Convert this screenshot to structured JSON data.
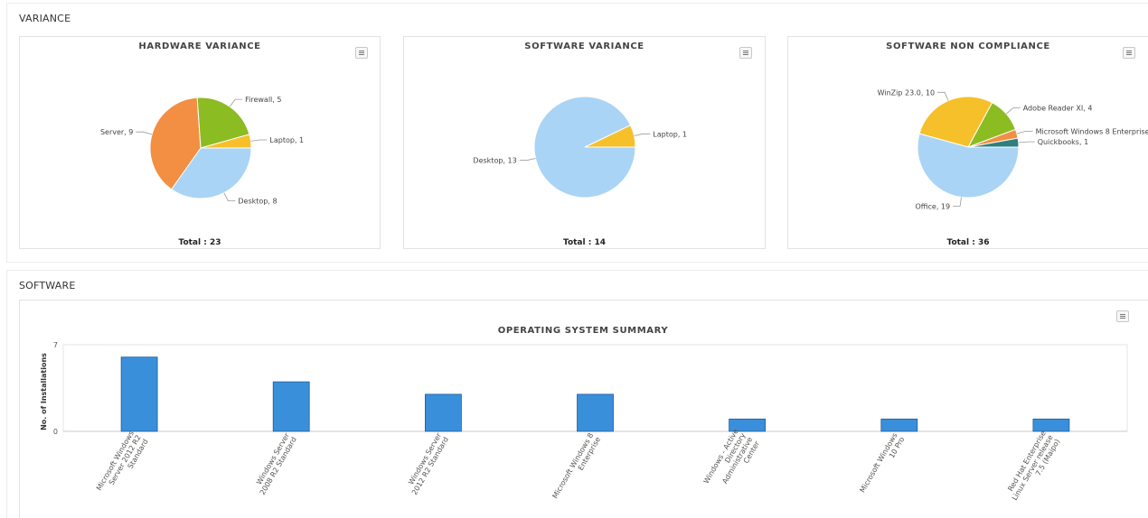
{
  "variance_section": {
    "title": "VARIANCE"
  },
  "software_section": {
    "title": "SOFTWARE"
  },
  "chart_data": [
    {
      "type": "pie",
      "title": "HARDWARE VARIANCE",
      "total_label": "Total : 23",
      "slices": [
        {
          "label": "Desktop, 8",
          "value": 8,
          "color": "#aad4f5"
        },
        {
          "label": "Server, 9",
          "value": 9,
          "color": "#f28f43"
        },
        {
          "label": "Firewall, 5",
          "value": 5,
          "color": "#8bbc21"
        },
        {
          "label": "Laptop, 1",
          "value": 1,
          "color": "#f6c02a"
        }
      ]
    },
    {
      "type": "pie",
      "title": "SOFTWARE VARIANCE",
      "total_label": "Total : 14",
      "slices": [
        {
          "label": "Laptop, 1",
          "value": 1,
          "color": "#f6c02a"
        },
        {
          "label": "Desktop, 13",
          "value": 13,
          "color": "#aad4f5"
        }
      ]
    },
    {
      "type": "pie",
      "title": "SOFTWARE NON COMPLIANCE",
      "total_label": "Total : 36",
      "slices": [
        {
          "label": "Quickbooks, 1",
          "value": 1,
          "color": "#2f7f7e"
        },
        {
          "label": "Microsoft Windows 8 Enterprise",
          "value": 1,
          "color": "#f28f43"
        },
        {
          "label": "Adobe Reader XI, 4",
          "value": 4,
          "color": "#8bbc21"
        },
        {
          "label": "WinZip 23.0, 10",
          "value": 10,
          "color": "#f6c02a"
        },
        {
          "label": "Office, 19",
          "value": 19,
          "color": "#aad4f5"
        }
      ]
    },
    {
      "type": "bar",
      "title": "OPERATING SYSTEM SUMMARY",
      "ylabel": "No. of Installations",
      "ylim": [
        0,
        7
      ],
      "yticks": [
        "0",
        "7"
      ],
      "color": "#3a8fdb",
      "categories": [
        [
          "Microsoft Windows",
          "Server 2012 R2",
          "Standard"
        ],
        [
          "Windows Server",
          "2008 R2 Standard"
        ],
        [
          "Windows Server",
          "2012 R2 Standard"
        ],
        [
          "Microsoft Windows 8",
          "Enterprise"
        ],
        [
          "Windows - Active",
          "Directory",
          "Administrative",
          "Center"
        ],
        [
          "Microsoft Windows",
          "10 Pro"
        ],
        [
          "Red Hat Enterprise",
          "Linux Server release",
          "7.5 (Maipo)"
        ]
      ],
      "values": [
        6,
        4,
        3,
        3,
        1,
        1,
        1
      ]
    }
  ]
}
